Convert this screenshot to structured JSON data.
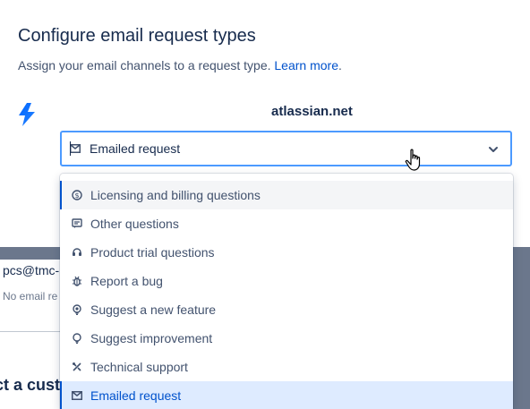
{
  "header": {
    "title": "Configure email request types",
    "subtitle": "Assign your email channels to a request type.",
    "learn_more": "Learn more"
  },
  "channel": {
    "domain": "atlassian.net",
    "selected_value": "Emailed request"
  },
  "background": {
    "email_partial": "pcs@tmc-",
    "no_email_partial": "No email re",
    "heading_partial": "ct a custo"
  },
  "options": [
    {
      "label": "Licensing and billing questions",
      "icon": "dollar-icon",
      "state": "hover"
    },
    {
      "label": "Other questions",
      "icon": "comment-icon",
      "state": ""
    },
    {
      "label": "Product trial questions",
      "icon": "headset-icon",
      "state": ""
    },
    {
      "label": "Report a bug",
      "icon": "bug-icon",
      "state": ""
    },
    {
      "label": "Suggest a new feature",
      "icon": "lightbulb-filled-icon",
      "state": ""
    },
    {
      "label": "Suggest improvement",
      "icon": "lightbulb-icon",
      "state": ""
    },
    {
      "label": "Technical support",
      "icon": "tools-icon",
      "state": ""
    },
    {
      "label": "Emailed request",
      "icon": "envelope-icon",
      "state": "selected"
    }
  ],
  "colors": {
    "brand": "#0052cc",
    "focus_border": "#4c9aff",
    "selected_bg": "#deebff",
    "hover_bg": "#f4f5f7",
    "text": "#172b4d",
    "text_subtle": "#42526e"
  }
}
